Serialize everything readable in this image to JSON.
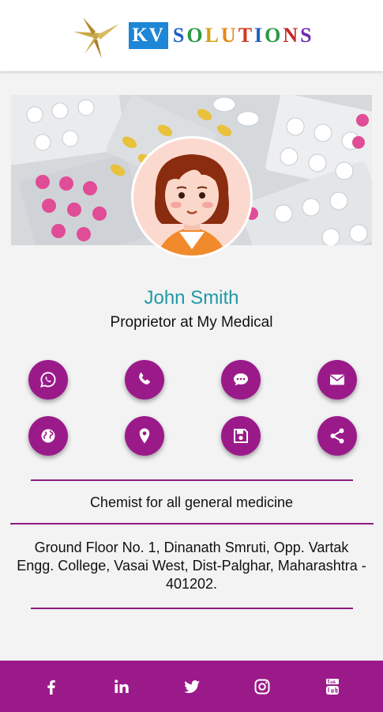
{
  "brand": {
    "kv": "KV",
    "word_letters": [
      "S",
      "O",
      "L",
      "U",
      "T",
      "I",
      "O",
      "N",
      "S"
    ]
  },
  "profile": {
    "name": "John Smith",
    "title": "Proprietor at My Medical"
  },
  "actions": [
    {
      "name": "whatsapp-button",
      "icon": "whatsapp-icon"
    },
    {
      "name": "call-button",
      "icon": "phone-icon"
    },
    {
      "name": "sms-button",
      "icon": "chat-icon"
    },
    {
      "name": "email-button",
      "icon": "envelope-icon"
    },
    {
      "name": "website-button",
      "icon": "globe-icon"
    },
    {
      "name": "location-button",
      "icon": "map-pin-icon"
    },
    {
      "name": "save-contact-button",
      "icon": "floppy-disk-icon"
    },
    {
      "name": "share-button",
      "icon": "share-icon"
    }
  ],
  "description": "Chemist for all general medicine",
  "address": "Ground Floor No. 1, Dinanath Smruti, Opp. Vartak Engg. College, Vasai West, Dist-Palghar, Maharashtra - 401202.",
  "social": [
    {
      "name": "facebook-link",
      "icon": "facebook-icon"
    },
    {
      "name": "linkedin-link",
      "icon": "linkedin-icon"
    },
    {
      "name": "twitter-link",
      "icon": "twitter-icon"
    },
    {
      "name": "instagram-link",
      "icon": "instagram-icon"
    },
    {
      "name": "youtube-link",
      "icon": "youtube-icon"
    }
  ],
  "colors": {
    "accent": "#9b1a8a",
    "name_teal": "#1e9aa6",
    "background": "#f3f3f4"
  }
}
